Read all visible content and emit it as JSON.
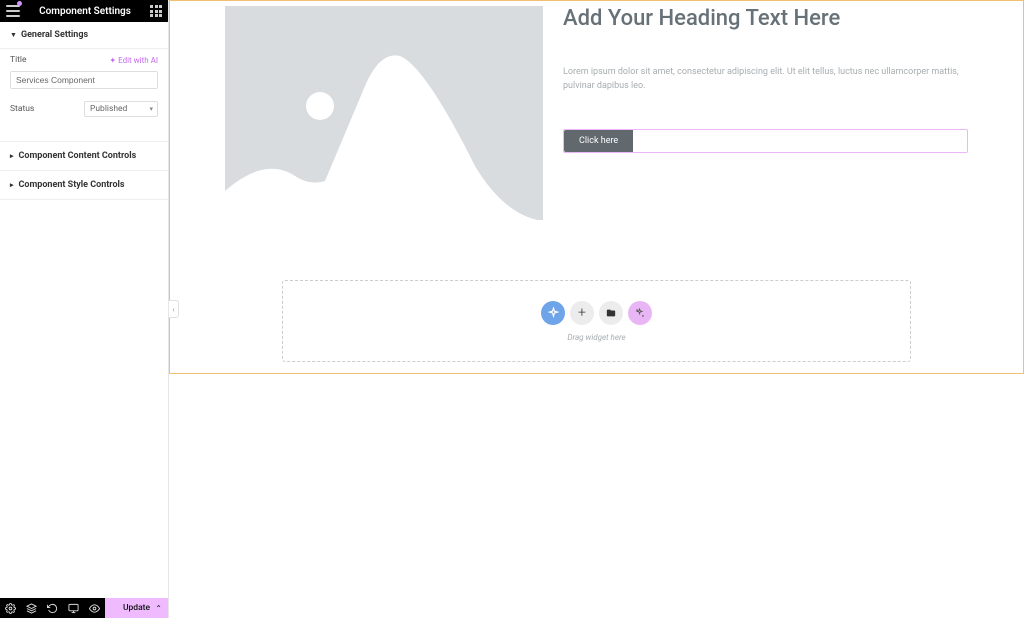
{
  "sidebar": {
    "title": "Component Settings",
    "sections": {
      "general": "General Settings",
      "content": "Component Content Controls",
      "style": "Component Style Controls"
    },
    "title_field": {
      "label": "Title",
      "value": "Services Component",
      "ai_link": "Edit with AI"
    },
    "status_field": {
      "label": "Status",
      "value": "Published"
    }
  },
  "bottom_bar": {
    "update": "Update"
  },
  "canvas": {
    "heading": "Add Your Heading Text Here",
    "lorem": "Lorem ipsum dolor sit amet, consectetur adipiscing elit. Ut elit tellus, luctus nec ullamcorper mattis, pulvinar dapibus leo.",
    "cta": "Click here",
    "drop_hint": "Drag widget here"
  }
}
